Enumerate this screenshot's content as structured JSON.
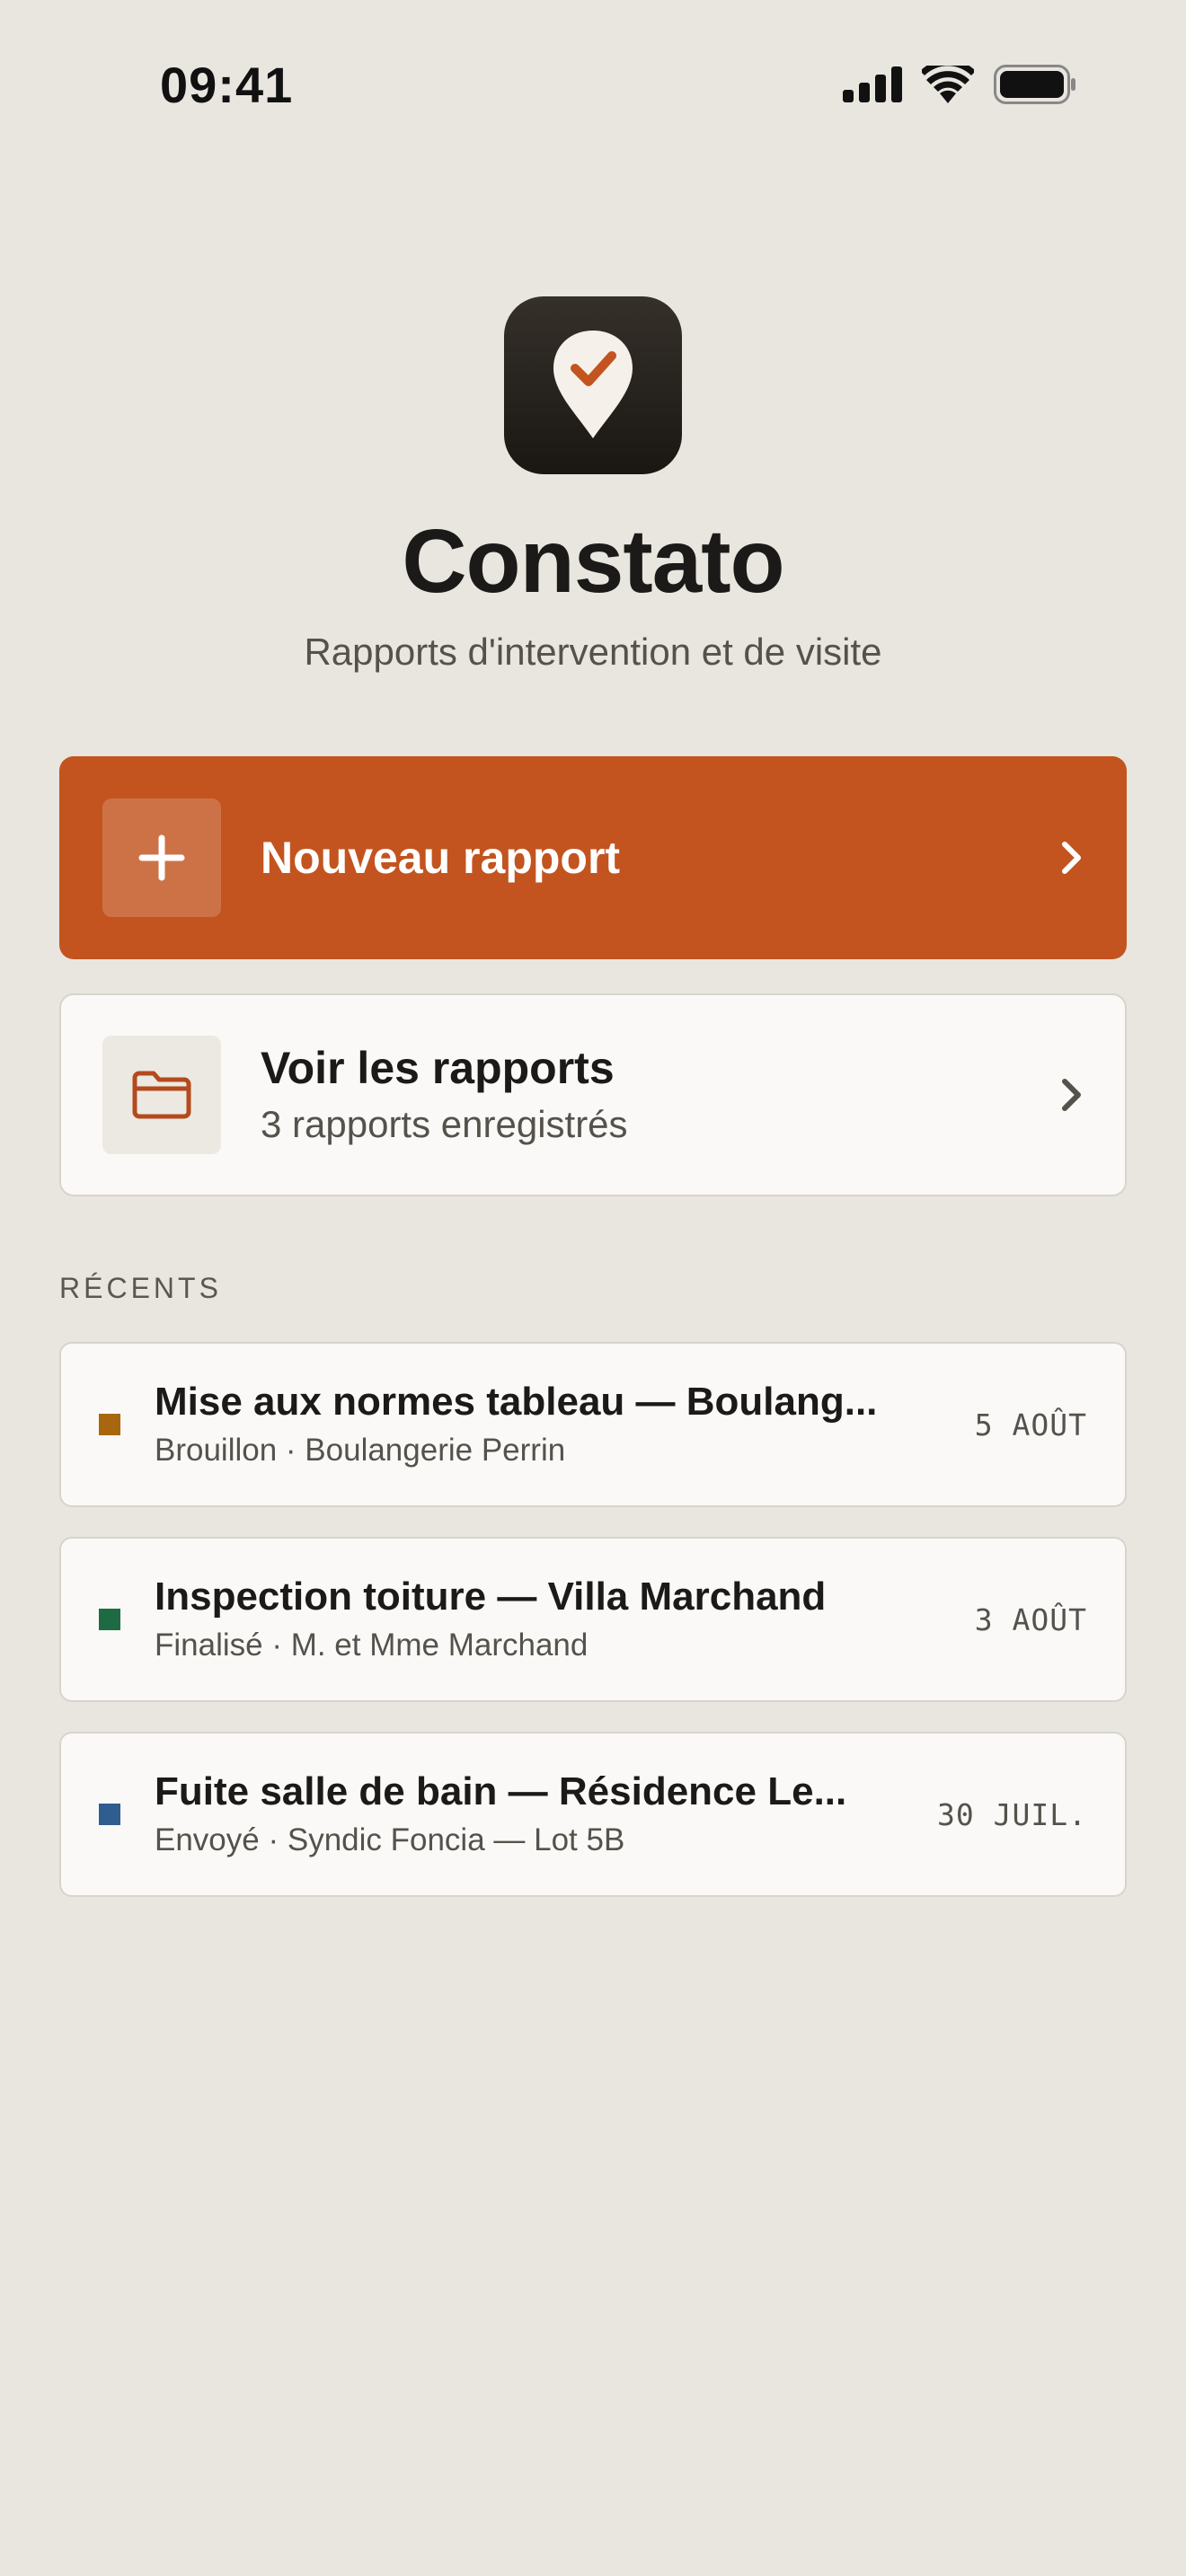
{
  "status_bar": {
    "time": "09:41",
    "icons": [
      "cellular-signal-icon",
      "wifi-icon",
      "battery-icon"
    ]
  },
  "header": {
    "app_icon": "map-pin-check-icon",
    "title": "Constato",
    "subtitle": "Rapports d'intervention et de visite"
  },
  "actions": {
    "new_report": {
      "label": "Nouveau rapport",
      "icon": "plus-icon"
    },
    "view_reports": {
      "label": "Voir les rapports",
      "count_text": "3 rapports enregistrés",
      "icon": "folder-icon"
    }
  },
  "recents": {
    "section_label": "RÉCENTS",
    "items": [
      {
        "title": "Mise aux normes tableau — Boulang...",
        "meta": "Brouillon · Boulangerie Perrin",
        "date": "5 AOÛT",
        "status_color": "#a8660f"
      },
      {
        "title": "Inspection toiture — Villa Marchand",
        "meta": "Finalisé · M. et Mme Marchand",
        "date": "3 AOÛT",
        "status_color": "#1e6b43"
      },
      {
        "title": "Fuite salle de bain — Résidence Le...",
        "meta": "Envoyé · Syndic Foncia — Lot 5B",
        "date": "30 JUIL.",
        "status_color": "#2f5d8f"
      }
    ]
  },
  "colors": {
    "background": "#e9e6df",
    "accent": "#c3541f",
    "card": "#faf9f7",
    "text_primary": "#1b1a18",
    "text_secondary": "#55524c"
  }
}
